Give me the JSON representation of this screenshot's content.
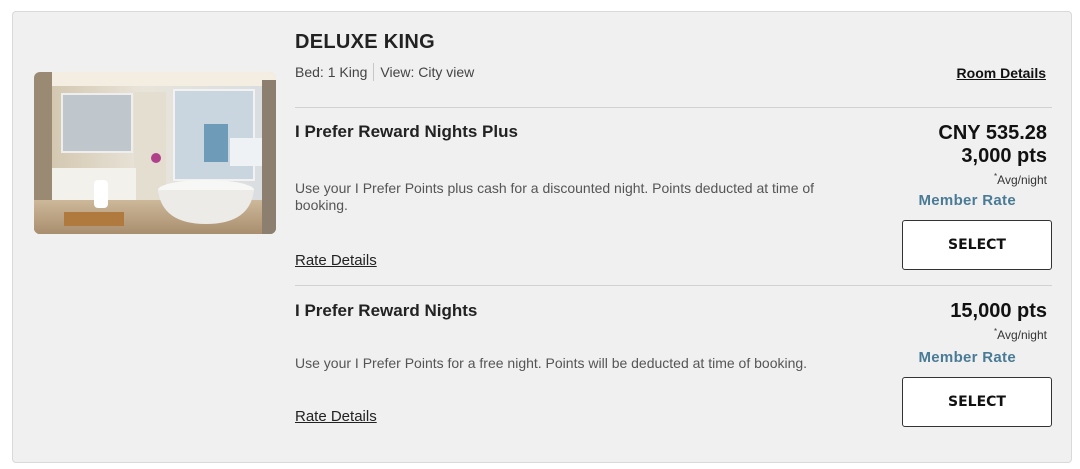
{
  "room": {
    "title": "DELUXE KING",
    "bed": "Bed: 1 King",
    "view": "View: City view",
    "details_link": "Room Details",
    "photo_icon": "bathroom-photo"
  },
  "rates": [
    {
      "name": "I Prefer Reward Nights Plus",
      "description": "Use your I Prefer Points plus cash for a discounted night. Points deducted at time of booking.",
      "details_link": "Rate Details",
      "price_cash": "CNY 535.28",
      "price_points": "3,000 pts",
      "avg_marker": "*",
      "avg_label": "Avg/night",
      "member_rate": "Member Rate",
      "select_label": "SELECT"
    },
    {
      "name": "I Prefer Reward Nights",
      "description": "Use your I Prefer Points for a free night. Points will be deducted at time of booking.",
      "details_link": "Rate Details",
      "price_points": "15,000 pts",
      "avg_marker": "*",
      "avg_label": "Avg/night",
      "member_rate": "Member Rate",
      "select_label": "SELECT"
    }
  ],
  "colors": {
    "card_bg": "#f0f0f0",
    "member_rate": "#4a7b96",
    "button_border": "#333333"
  }
}
